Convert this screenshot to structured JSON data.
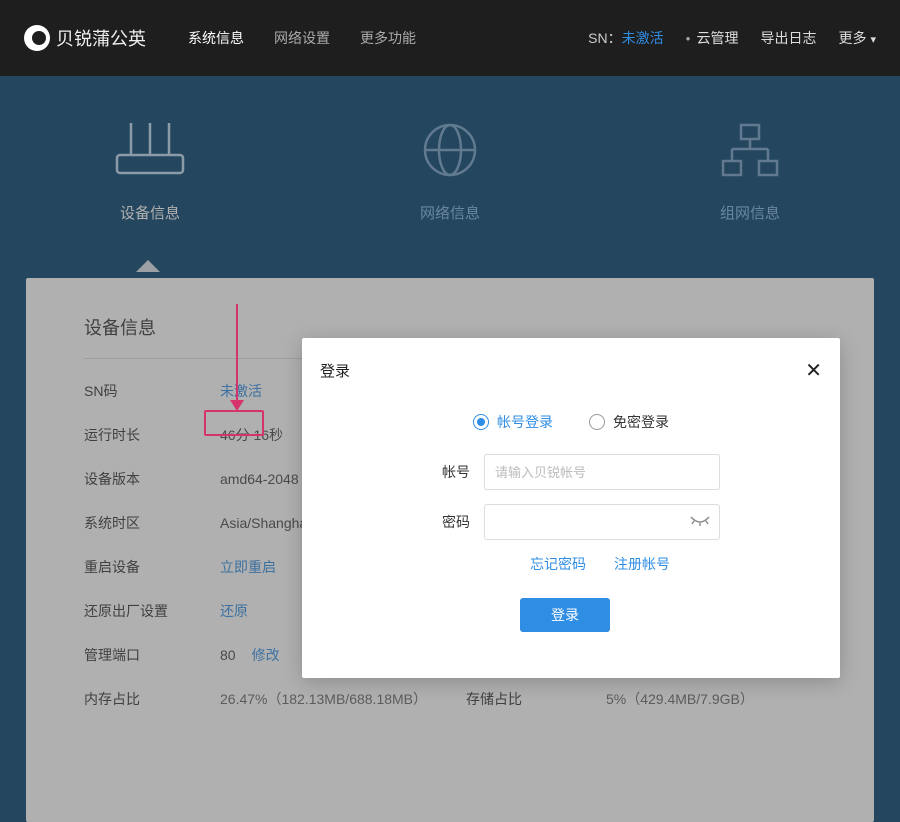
{
  "logo_text": "贝锐蒲公英",
  "topnav": [
    "系统信息",
    "网络设置",
    "更多功能"
  ],
  "topright": {
    "sn_label": "SN：",
    "sn_value": "未激活",
    "cloud": "云管理",
    "export": "导出日志",
    "more": "更多"
  },
  "tabs": [
    "设备信息",
    "网络信息",
    "组网信息"
  ],
  "panel_title": "设备信息",
  "rows": {
    "sn_label": "SN码",
    "sn_link": "未激活",
    "uptime_label": "运行时长",
    "uptime_value": "46分 16秒",
    "version_label": "设备版本",
    "version_value": "amd64-2048",
    "tz_label": "系统时区",
    "tz_value": "Asia/Shangha",
    "reboot_label": "重启设备",
    "reboot_link": "立即重启",
    "reset_label": "还原出厂设置",
    "reset_link": "还原",
    "port_label": "管理端口",
    "port_value": "80",
    "port_link": "修改",
    "mem_label": "内存占比",
    "mem_value": "26.47%（182.13MB/688.18MB）",
    "storage_label": "存储占比",
    "storage_value": "5%（429.4MB/7.9GB）"
  },
  "modal": {
    "title": "登录",
    "tab_account": "帐号登录",
    "tab_noauth": "免密登录",
    "account_label": "帐号",
    "account_placeholder": "请输入贝锐帐号",
    "password_label": "密码",
    "forgot": "忘记密码",
    "register": "注册帐号",
    "login_btn": "登录"
  }
}
